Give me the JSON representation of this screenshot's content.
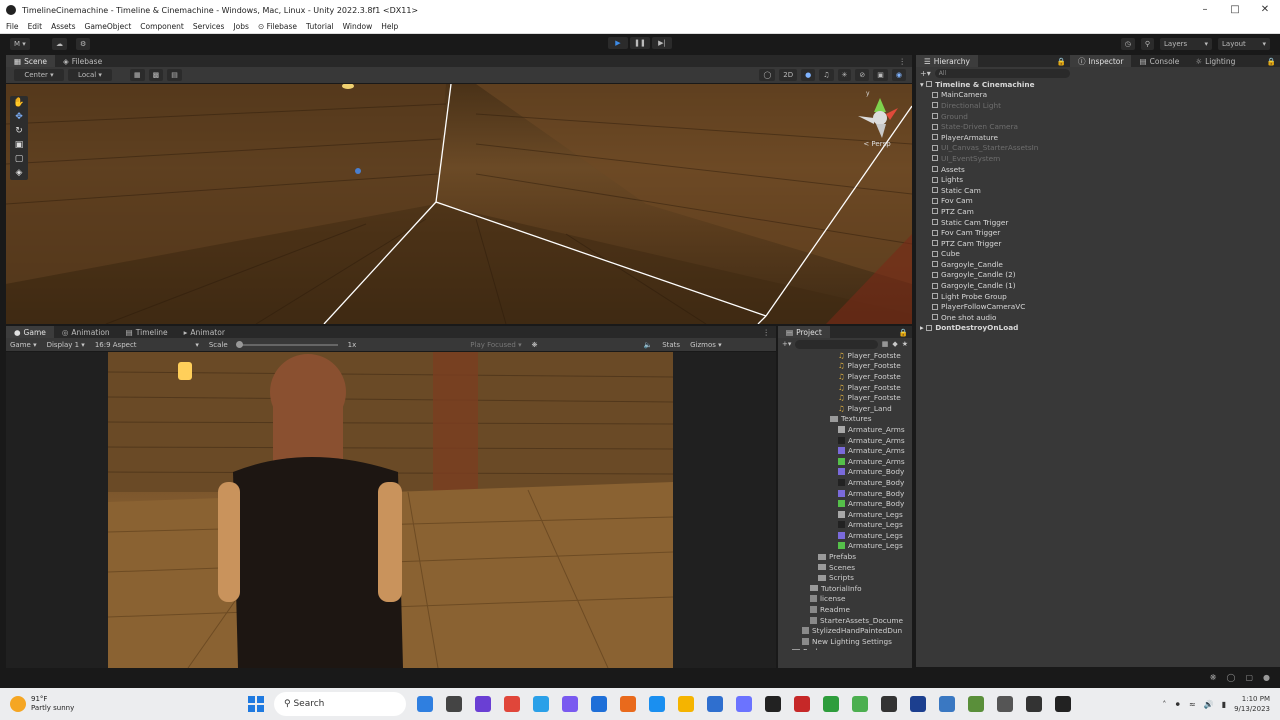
{
  "window": {
    "title": "TimelineCinemachine - Timeline & Cinemachine - Windows, Mac, Linux - Unity 2022.3.8f1 <DX11>"
  },
  "menu": [
    "File",
    "Edit",
    "Assets",
    "GameObject",
    "Component",
    "Services",
    "Jobs",
    "⊙ Filebase",
    "Tutorial",
    "Window",
    "Help"
  ],
  "toolbar": {
    "account": "M",
    "layers": "Layers",
    "layout": "Layout"
  },
  "scene_tabs": [
    "Scene",
    "Filebase"
  ],
  "scene_toolbar": {
    "pivot": "Center",
    "space": "Local",
    "mode2d": "2D"
  },
  "gizmo": {
    "label": "< Persp",
    "axis_y": "y"
  },
  "game_tabs": [
    "Game",
    "Animation",
    "Timeline",
    "Animator"
  ],
  "game_toolbar": {
    "mode": "Game",
    "display": "Display 1",
    "aspect": "16:9 Aspect",
    "scale_label": "Scale",
    "scale_value": "1x",
    "play_focused": "Play Focused",
    "stats": "Stats",
    "gizmos": "Gizmos"
  },
  "right_tabs": [
    "Hierarchy",
    "Inspector",
    "Console",
    "Lighting"
  ],
  "hierarchy": {
    "search": "All",
    "scene": "Timeline & Cinemachine",
    "items": [
      {
        "label": "MainCamera",
        "dim": false
      },
      {
        "label": "Directional Light",
        "dim": true
      },
      {
        "label": "Ground",
        "dim": true
      },
      {
        "label": "State-Driven Camera",
        "dim": true
      },
      {
        "label": "PlayerArmature",
        "dim": false
      },
      {
        "label": "UI_Canvas_StarterAssetsIn",
        "dim": true
      },
      {
        "label": "UI_EventSystem",
        "dim": true
      },
      {
        "label": "Assets",
        "dim": false
      },
      {
        "label": "Lights",
        "dim": false
      },
      {
        "label": "Static Cam",
        "dim": false
      },
      {
        "label": "Fov Cam",
        "dim": false
      },
      {
        "label": "PTZ Cam",
        "dim": false
      },
      {
        "label": "Static Cam Trigger",
        "dim": false
      },
      {
        "label": "Fov Cam Trigger",
        "dim": false
      },
      {
        "label": "PTZ Cam Trigger",
        "dim": false
      },
      {
        "label": "Cube",
        "dim": false
      },
      {
        "label": "Gargoyle_Candle",
        "dim": false
      },
      {
        "label": "Gargoyle_Candle (2)",
        "dim": false
      },
      {
        "label": "Gargoyle_Candle (1)",
        "dim": false
      },
      {
        "label": "Light Probe Group",
        "dim": false
      },
      {
        "label": "PlayerFollowCameraVC",
        "dim": false
      },
      {
        "label": "One shot audio",
        "dim": false
      }
    ],
    "dont_destroy": "DontDestroyOnLoad"
  },
  "project": {
    "tab": "Project",
    "audio": [
      "Player_Footste",
      "Player_Footste",
      "Player_Footste",
      "Player_Footste",
      "Player_Footste",
      "Player_Land"
    ],
    "textures_folder": "Textures",
    "textures": [
      {
        "label": "Armature_Arms",
        "color": "#a8a8a8"
      },
      {
        "label": "Armature_Arms",
        "color": "#222222"
      },
      {
        "label": "Armature_Arms",
        "color": "#7a6adb"
      },
      {
        "label": "Armature_Arms",
        "color": "#55c04a"
      },
      {
        "label": "Armature_Body",
        "color": "#7a6adb"
      },
      {
        "label": "Armature_Body",
        "color": "#222222"
      },
      {
        "label": "Armature_Body",
        "color": "#7a6adb"
      },
      {
        "label": "Armature_Body",
        "color": "#55c04a"
      },
      {
        "label": "Armature_Legs",
        "color": "#a8a8a8"
      },
      {
        "label": "Armature_Legs",
        "color": "#222222"
      },
      {
        "label": "Armature_Legs",
        "color": "#7a6adb"
      },
      {
        "label": "Armature_Legs",
        "color": "#55c04a"
      }
    ],
    "folders": [
      "Prefabs",
      "Scenes",
      "Scripts"
    ],
    "root_items": [
      "TutorialInfo",
      "license",
      "Readme",
      "StarterAssets_Docume",
      "StylizedHandPaintedDun",
      "New Lighting Settings"
    ],
    "packages": "Packages"
  },
  "taskbar": {
    "weather_temp": "91°F",
    "weather_desc": "Partly sunny",
    "search": "Search",
    "time": "1:10 PM",
    "date": "9/13/2023",
    "icons": [
      "#2f7fe0",
      "#444",
      "#6a3fd4",
      "#e0463a",
      "#2aa0e8",
      "#7a5af0",
      "#1e6fd8",
      "#e96a1c",
      "#1a8ff0",
      "#f5b400",
      "#2f6fcf",
      "#6b73ff",
      "#222",
      "#c62828",
      "#2e9d3c",
      "#4caf50",
      "#333",
      "#1c3f8f",
      "#3a78c2",
      "#5a8f3a",
      "#555",
      "#333",
      "#222"
    ]
  }
}
